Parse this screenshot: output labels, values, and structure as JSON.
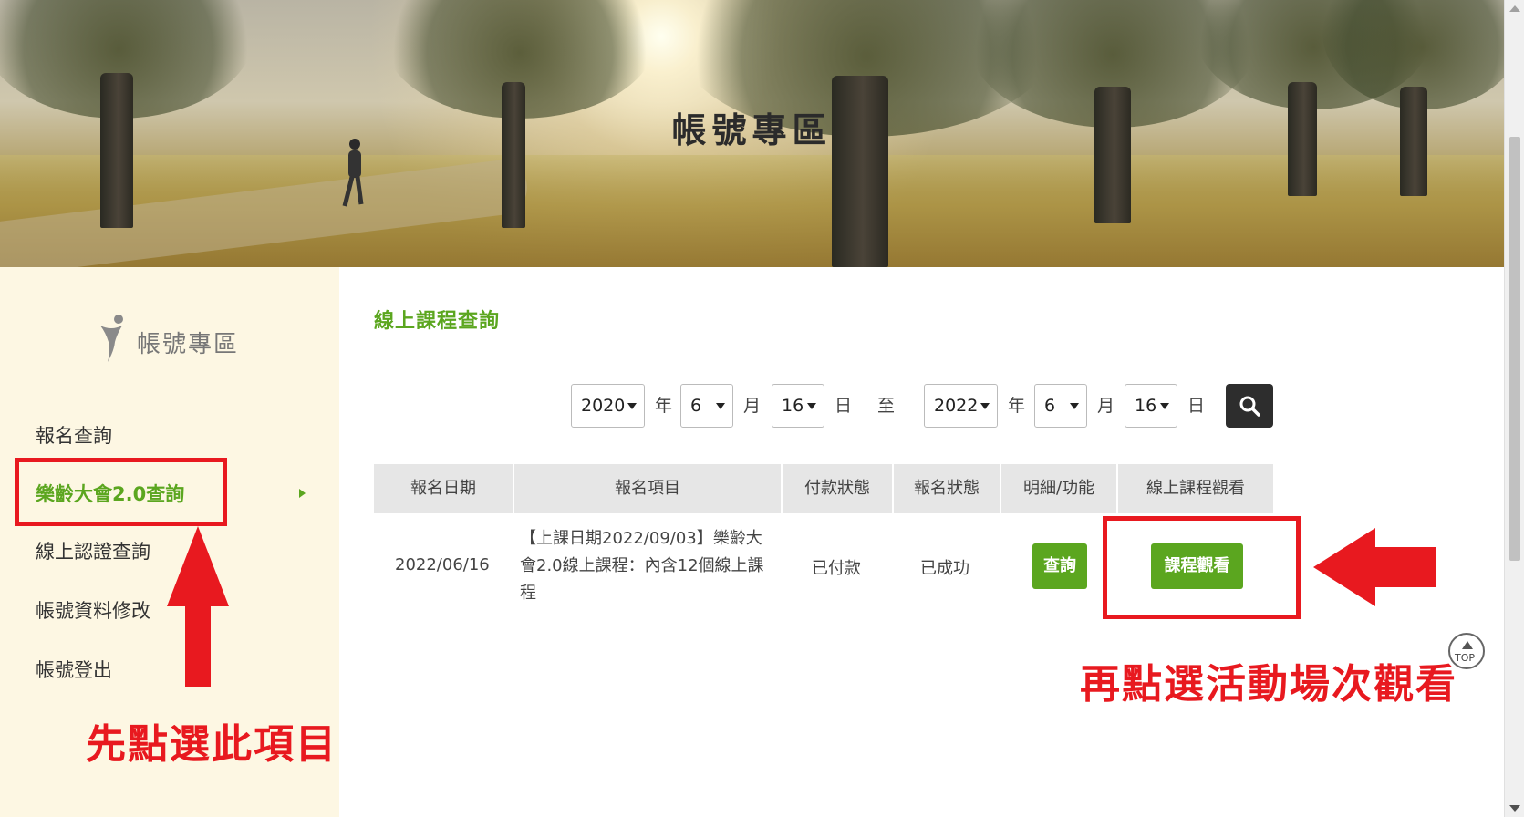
{
  "banner": {
    "title": "帳號專區"
  },
  "sidebar": {
    "logo_text": "帳號專區",
    "items": [
      {
        "label": "報名查詢"
      },
      {
        "label": "樂齡大會2.0查詢"
      },
      {
        "label": "線上認證查詢"
      },
      {
        "label": "帳號資料修改"
      },
      {
        "label": "帳號登出"
      }
    ]
  },
  "main": {
    "title": "線上課程查詢",
    "filter": {
      "from_year": "2020",
      "from_month": "6",
      "from_day": "16",
      "to_year": "2022",
      "to_month": "6",
      "to_day": "16",
      "unit_year": "年",
      "unit_month": "月",
      "unit_day": "日",
      "to_label": "至"
    },
    "table": {
      "headers": [
        "報名日期",
        "報名項目",
        "付款狀態",
        "報名狀態",
        "明細/功能",
        "線上課程觀看"
      ],
      "rows": [
        {
          "date": "2022/06/16",
          "item": "【上課日期2022/09/03】樂齡大會2.0線上課程：內含12個線上課程",
          "payment": "已付款",
          "status": "已成功",
          "detail_button": "查詢",
          "watch_button": "課程觀看"
        }
      ]
    }
  },
  "annotations": {
    "left_text": "先點選此項目",
    "right_text": "再點選活動場次觀看",
    "color": "#e8191f"
  },
  "top_button": {
    "label": "TOP"
  },
  "colors": {
    "accent": "#5ba61f",
    "sidebar_bg": "#fdf7e3",
    "search_button": "#2d2d2d"
  }
}
